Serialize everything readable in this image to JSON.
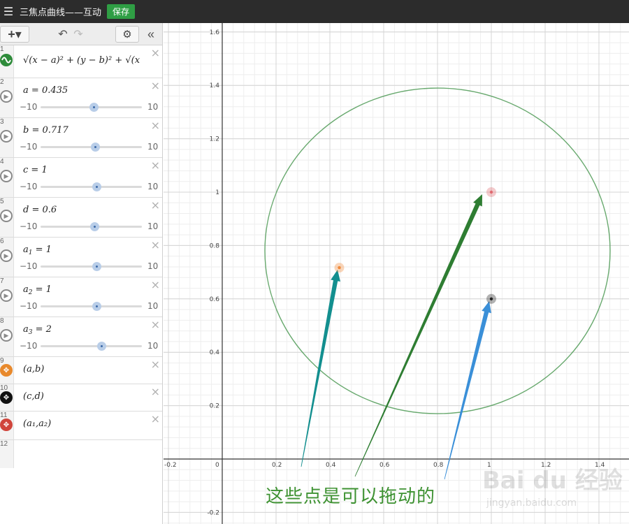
{
  "topbar": {
    "menu_icon": "hamburger-icon",
    "title": "三焦点曲线——互动",
    "save_label": "保存"
  },
  "toolbar": {
    "add_label": "+▾",
    "undo_icon": "undo-icon",
    "redo_icon": "redo-icon",
    "settings_icon": "gear-icon",
    "collapse_icon": "double-chevron-left-icon"
  },
  "expressions": [
    {
      "num": "1",
      "icon": "sine-wave-icon",
      "formula": "√(x − a)² + (y − b)² + √(x"
    },
    {
      "num": "2",
      "var": "a",
      "value": "0.435",
      "min": "−10",
      "max": "10",
      "slider_fraction": 0.522
    },
    {
      "num": "3",
      "var": "b",
      "value": "0.717",
      "min": "−10",
      "max": "10",
      "slider_fraction": 0.536
    },
    {
      "num": "4",
      "var": "c",
      "value": "1",
      "min": "−10",
      "max": "10",
      "slider_fraction": 0.55
    },
    {
      "num": "5",
      "var": "d",
      "value": "0.6",
      "min": "−10",
      "max": "10",
      "slider_fraction": 0.53
    },
    {
      "num": "6",
      "var": "a",
      "sub": "1",
      "value": "1",
      "min": "−10",
      "max": "10",
      "slider_fraction": 0.55
    },
    {
      "num": "7",
      "var": "a",
      "sub": "2",
      "value": "1",
      "min": "−10",
      "max": "10",
      "slider_fraction": 0.55
    },
    {
      "num": "8",
      "var": "a",
      "sub": "3",
      "value": "2",
      "min": "−10",
      "max": "10",
      "slider_fraction": 0.6
    },
    {
      "num": "9",
      "point": "(a,b)",
      "color": "#e8892c"
    },
    {
      "num": "10",
      "point": "(c,d)",
      "color": "#111111"
    },
    {
      "num": "11",
      "point": "(a₁,a₂)",
      "color": "#d0453c"
    },
    {
      "num": "12"
    }
  ],
  "graph": {
    "x_ticks": [
      "-0.2",
      "0",
      "0.2",
      "0.4",
      "0.6",
      "0.8",
      "1",
      "1.2",
      "1.4"
    ],
    "y_ticks": [
      "1.6",
      "1.4",
      "1.2",
      "1",
      "0.8",
      "0.6",
      "0.4",
      "0.2",
      "-0.2"
    ],
    "curve_color": "#4e9a55",
    "points": [
      {
        "label": "(a,b)",
        "x": 0.435,
        "y": 0.717,
        "color": "#f0893a"
      },
      {
        "label": "(c,d)",
        "x": 1,
        "y": 0.6,
        "color": "#222222"
      },
      {
        "label": "(a1,a2)",
        "x": 1,
        "y": 1,
        "color": "#e06a70"
      }
    ],
    "arrows": [
      {
        "color": "#138f8f"
      },
      {
        "color": "#2e7d32"
      },
      {
        "color": "#3a8fd8"
      }
    ]
  },
  "caption": "这些点是可以拖动的",
  "watermark": {
    "text": "Bai du 经验",
    "url": "jingyan.baidu.com"
  }
}
